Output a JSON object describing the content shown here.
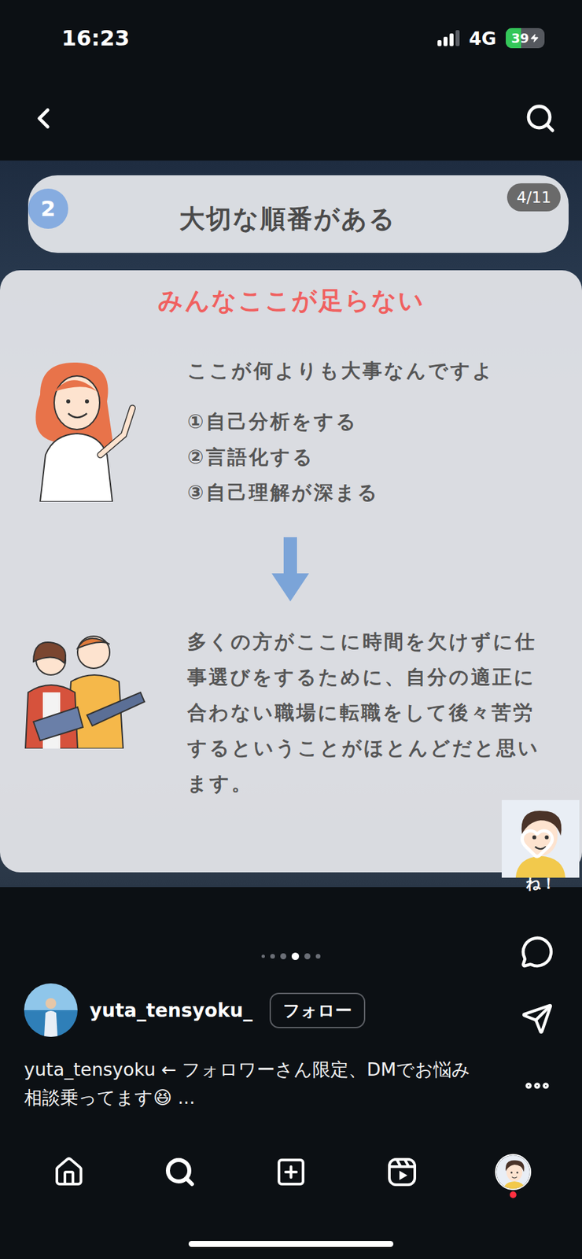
{
  "status_bar": {
    "time": "16:23",
    "signal_level": 0.75,
    "network": "4G",
    "battery": "39",
    "battery_level": 0.39,
    "charging": true
  },
  "slide": {
    "step": "2",
    "title": "大切な順番がある",
    "counter": "4/11",
    "heading": "みんなここが足らない",
    "intro": "ここが何よりも大事なんですよ",
    "steps": [
      "①自己分析をする",
      "②言語化する",
      "③自己理解が深まる"
    ],
    "body": "多くの方がここに時間を欠けずに仕事選びをするために、自分の適正に合わない職場に転職をして後々苦労するということがほとんどだと思います。",
    "sticker_text": "ね！"
  },
  "carousel": {
    "dots": [
      {
        "selected": false
      },
      {
        "selected": false
      },
      {
        "selected": false
      },
      {
        "selected": true
      },
      {
        "selected": false
      },
      {
        "selected": false
      }
    ]
  },
  "post": {
    "username": "yuta_tensyoku_",
    "follow_label": "フォロー",
    "caption": "yuta_tensyoku ← フォロワーさん限定、DMでお悩み相談乗ってます😆 ...",
    "liked": false
  },
  "bottom_nav": [
    {
      "kind": "home",
      "selected": false,
      "notification": false
    },
    {
      "kind": "search",
      "selected": true,
      "notification": false
    },
    {
      "kind": "create",
      "selected": false,
      "notification": false
    },
    {
      "kind": "reels",
      "selected": false,
      "notification": false
    },
    {
      "kind": "profile",
      "selected": false,
      "notification": true
    }
  ]
}
